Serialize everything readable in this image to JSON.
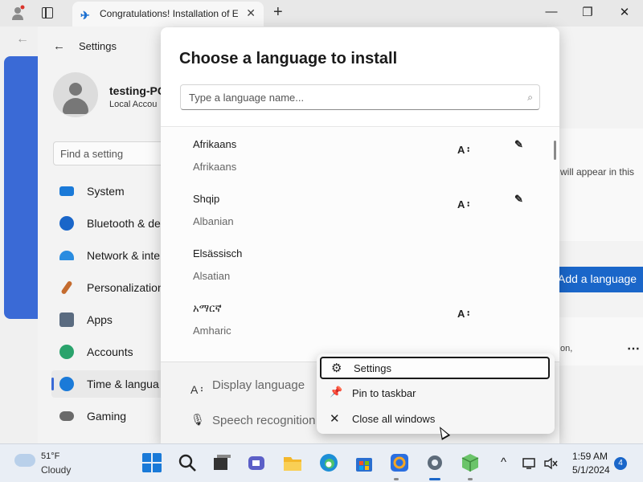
{
  "browser": {
    "tab_title": "Congratulations! Installation of E",
    "tab_close": "✕",
    "new_tab": "+",
    "minimize": "—",
    "restore": "❐",
    "close": "✕"
  },
  "settings": {
    "back": "←",
    "title": "Settings",
    "user_name": "testing-PC",
    "user_type": "Local Accou",
    "search_placeholder": "Find a setting",
    "nav": [
      {
        "label": "System",
        "icon": "system-icon",
        "color": "#1a7ad8"
      },
      {
        "label": "Bluetooth & de",
        "icon": "bluetooth-icon",
        "color": "#1a66c9"
      },
      {
        "label": "Network & inte",
        "icon": "wifi-icon",
        "color": "#2a8ce0"
      },
      {
        "label": "Personalization",
        "icon": "brush-icon",
        "color": "#c46b2e"
      },
      {
        "label": "Apps",
        "icon": "apps-icon",
        "color": "#5a6b80"
      },
      {
        "label": "Accounts",
        "icon": "accounts-icon",
        "color": "#2aa36c"
      },
      {
        "label": "Time & langua",
        "icon": "globe-icon",
        "color": "#1a7ad8"
      },
      {
        "label": "Gaming",
        "icon": "gamepad-icon",
        "color": "#6a6a6a"
      }
    ],
    "right_text": "will appear in this",
    "add_language": "Add a language",
    "on_text": "on,",
    "more": "⋯"
  },
  "dialog": {
    "title": "Choose a language to install",
    "search_placeholder": "Type a language name...",
    "search_icon": "⌕",
    "languages": [
      {
        "native": "Afrikaans",
        "english": "Afrikaans",
        "cap_a": "A᠄",
        "cap_b": "✎"
      },
      {
        "native": "Shqip",
        "english": "Albanian",
        "cap_a": "A᠄",
        "cap_b": "✎"
      },
      {
        "native": "Elsässisch",
        "english": "Alsatian",
        "cap_a": "",
        "cap_b": ""
      },
      {
        "native": "አማርኛ",
        "english": "Amharic",
        "cap_a": "A᠄",
        "cap_b": ""
      }
    ],
    "footer": {
      "display_language": "Display language",
      "display_icon": "A᠄",
      "speech": "Speech recognition",
      "speech_icon": "🎙"
    }
  },
  "context_menu": {
    "items": [
      {
        "label": "Settings",
        "icon": "⚙"
      },
      {
        "label": "Pin to taskbar",
        "icon": "📌"
      },
      {
        "label": "Close all windows",
        "icon": "✕"
      }
    ]
  },
  "taskbar": {
    "temp": "51°F",
    "weather": "Cloudy",
    "time": "1:59 AM",
    "date": "5/1/2024",
    "notifications": "4",
    "chevron": "^"
  },
  "colors": {
    "accent": "#1a66c9",
    "dialog_bg": "#ffffff"
  }
}
